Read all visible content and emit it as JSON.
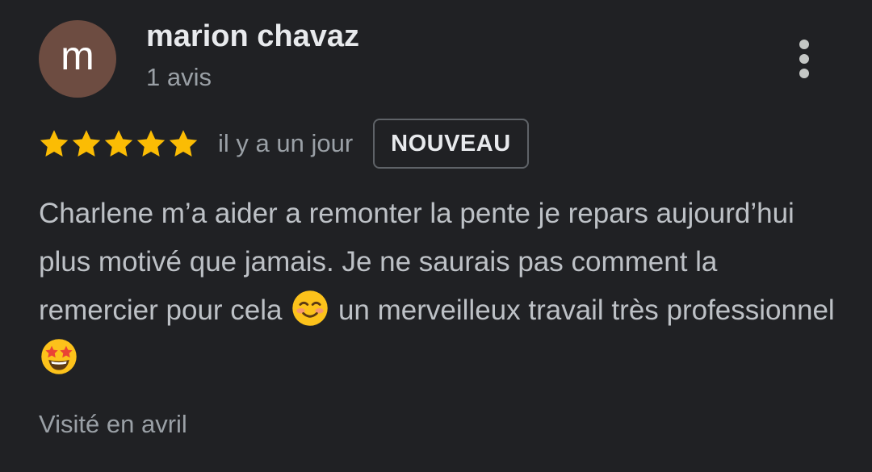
{
  "review": {
    "author": {
      "initial": "m",
      "name": "marion chavaz",
      "review_count": "1 avis",
      "avatar_color": "#6d4c41"
    },
    "rating": 5,
    "rating_max": 5,
    "date": "il y a un jour",
    "badge": "NOUVEAU",
    "text": {
      "part1": "Charlene m’a aider a remonter la pente je repars aujourd’hui plus motivé que jamais. Je ne saurais pas comment la remercier pour cela",
      "emoji1": "smiling-face-with-blush-emoji",
      "part2": "un merveilleux travail très professionnel",
      "emoji2": "star-struck-emoji"
    },
    "visit": "Visité en avril",
    "more_menu_icon": "more-vert-icon"
  },
  "colors": {
    "background": "#202124",
    "star": "#fbbc04",
    "primary_text": "#e8eaed",
    "secondary_text": "#9aa0a6",
    "body_text": "#bdc1c6",
    "badge_border": "#5f6368"
  }
}
